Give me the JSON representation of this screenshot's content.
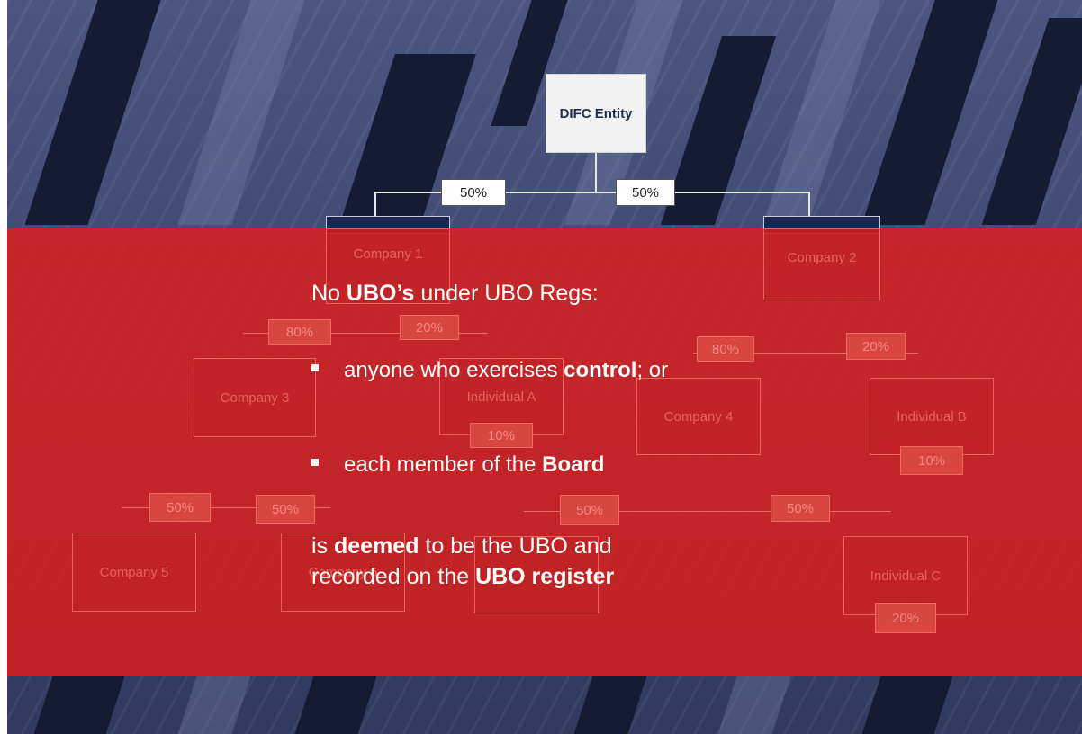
{
  "diagram": {
    "top_entity": "DIFC Entity",
    "top_split": [
      "50%",
      "50%"
    ],
    "companies": {
      "c1": "Company 1",
      "c2": "Company 2",
      "c3": "Company 3",
      "c4": "Company 4",
      "c5": "Company 5",
      "c6": "Company 6",
      "ia": "Individual A",
      "ib": "Individual B",
      "ic": "Individual C"
    },
    "pcts": {
      "c1_left": "80%",
      "c1_right": "20%",
      "c2_left": "80%",
      "c2_right": "20%",
      "ia": "10%",
      "ib": "10%",
      "c3_left": "50%",
      "c3_right": "50%",
      "c4_left": "50%",
      "c4_right": "50%",
      "ic": "20%"
    }
  },
  "overlay": {
    "heading_pre": "No ",
    "heading_bold": "UBO’s",
    "heading_post": " under UBO Regs:",
    "bullet1_pre": "anyone who exercises ",
    "bullet1_bold": "control",
    "bullet1_post": "; or",
    "bullet2_pre": "each member of the ",
    "bullet2_bold": "Board",
    "line1_pre": "is ",
    "line1_bold": "deemed",
    "line1_post": " to be the UBO and",
    "line2_pre": "recorded on the ",
    "line2_bold": "UBO register"
  },
  "colors": {
    "red_band": "#da201c",
    "navy": "#1a2450"
  }
}
